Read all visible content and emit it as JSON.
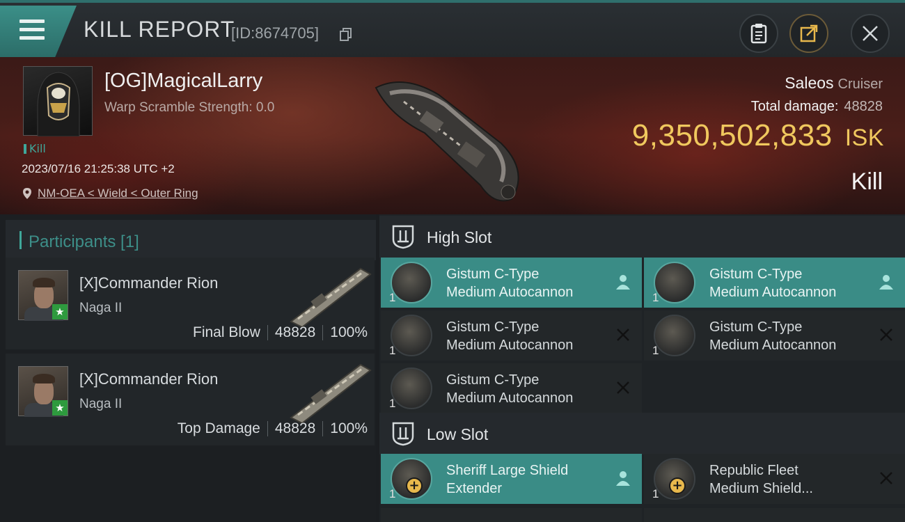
{
  "window": {
    "title": "KILL REPORT",
    "id_text": "[ID:8674705]"
  },
  "victim": {
    "pilot_name": "[OG]MagicalLarry",
    "warp_scramble": "Warp Scramble Strength: 0.0",
    "tag": "Kill",
    "datetime": "2023/07/16 21:25:38 UTC +2",
    "location": "NM-OEA < Wield < Outer Ring",
    "ship_name": "Saleos",
    "ship_class": "Cruiser",
    "total_damage_label": "Total damage:",
    "total_damage": "48828",
    "isk_value": "9,350,502,833",
    "isk_unit": "ISK",
    "result": "Kill"
  },
  "participants": {
    "header": "Participants [1]",
    "list": [
      {
        "name": "[X]Commander Rion",
        "ship": "Naga II",
        "role": "Final Blow",
        "damage": "48828",
        "percent": "100%"
      },
      {
        "name": "[X]Commander Rion",
        "ship": "Naga II",
        "role": "Top Damage",
        "damage": "48828",
        "percent": "100%"
      }
    ]
  },
  "fitting": {
    "high_slot": {
      "label": "High Slot",
      "modules": [
        {
          "line1": "Gistum C-Type",
          "line2": "Medium Autocannon",
          "qty": "1",
          "state": "person-icon",
          "active": true
        },
        {
          "line1": "Gistum C-Type",
          "line2": "Medium Autocannon",
          "qty": "1",
          "state": "person-icon",
          "active": true
        },
        {
          "line1": "Gistum C-Type",
          "line2": "Medium Autocannon",
          "qty": "1",
          "state": "x-icon",
          "active": false
        },
        {
          "line1": "Gistum C-Type",
          "line2": "Medium Autocannon",
          "qty": "1",
          "state": "x-icon",
          "active": false
        },
        {
          "line1": "Gistum C-Type",
          "line2": "Medium Autocannon",
          "qty": "1",
          "state": "x-icon",
          "active": false
        }
      ]
    },
    "low_slot": {
      "label": "Low Slot",
      "modules": [
        {
          "line1": "Sheriff Large Shield",
          "line2": "Extender",
          "qty": "1",
          "state": "person-icon",
          "active": true
        },
        {
          "line1": "Republic Fleet",
          "line2": "Medium Shield...",
          "qty": "1",
          "state": "x-icon",
          "active": false
        }
      ]
    }
  },
  "colors": {
    "accent_teal": "#3a8c86",
    "isk_gold": "#f0c85e",
    "header_red": "#4a1e19"
  }
}
